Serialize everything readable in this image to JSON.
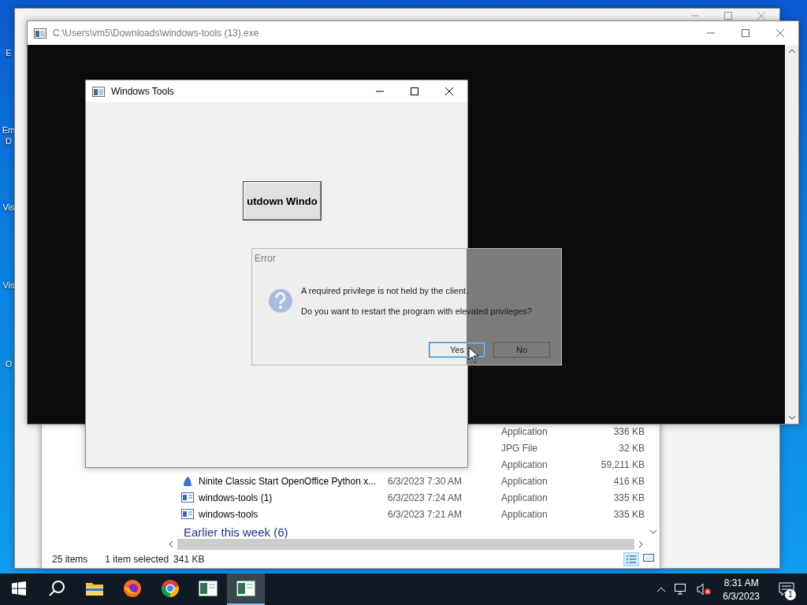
{
  "desktop_icons": [
    {
      "label": "E"
    },
    {
      "label": "Em D"
    },
    {
      "label": "Vis"
    },
    {
      "label": "Vis"
    },
    {
      "label": "O"
    }
  ],
  "explorer": {
    "rows": [
      {
        "type": "Application",
        "size": "336 KB"
      },
      {
        "type": "JPG File",
        "size": "32 KB"
      },
      {
        "type": "Application",
        "size": "59,211 KB"
      },
      {
        "kind": "ninite",
        "name": "Ninite Classic Start OpenOffice Python x...",
        "date": "6/3/2023 7:30 AM",
        "type": "Application",
        "size": "416 KB"
      },
      {
        "kind": "app",
        "name": "windows-tools (1)",
        "date": "6/3/2023 7:24 AM",
        "type": "Application",
        "size": "335 KB"
      },
      {
        "kind": "app",
        "name": "windows-tools",
        "date": "6/3/2023 7:21 AM",
        "type": "Application",
        "size": "335 KB"
      }
    ],
    "group": "Earlier this week (6)",
    "status": {
      "count": "25 items",
      "selection": "1 item selected",
      "size": "341 KB"
    }
  },
  "console": {
    "title": "C:\\Users\\vm5\\Downloads\\windows-tools (13).exe"
  },
  "app_window": {
    "title": "Windows Tools",
    "button": "utdown Windo"
  },
  "dialog": {
    "title": "Error",
    "message": "A required privilege is not held by the client.",
    "question": "Do you want to restart the program with elevated privileges?",
    "buttons": [
      {
        "label": "Yes",
        "focused": true
      },
      {
        "label": "No",
        "focused": false
      }
    ]
  },
  "taskbar": {
    "apps": [
      {
        "kind": "folder",
        "active": false
      },
      {
        "kind": "firefox",
        "active": false
      },
      {
        "kind": "chrome",
        "active": false
      },
      {
        "kind": "app",
        "active": false
      },
      {
        "kind": "app",
        "active": true
      }
    ],
    "time": "8:31 AM",
    "date": "6/3/2023",
    "notifications": "1"
  }
}
